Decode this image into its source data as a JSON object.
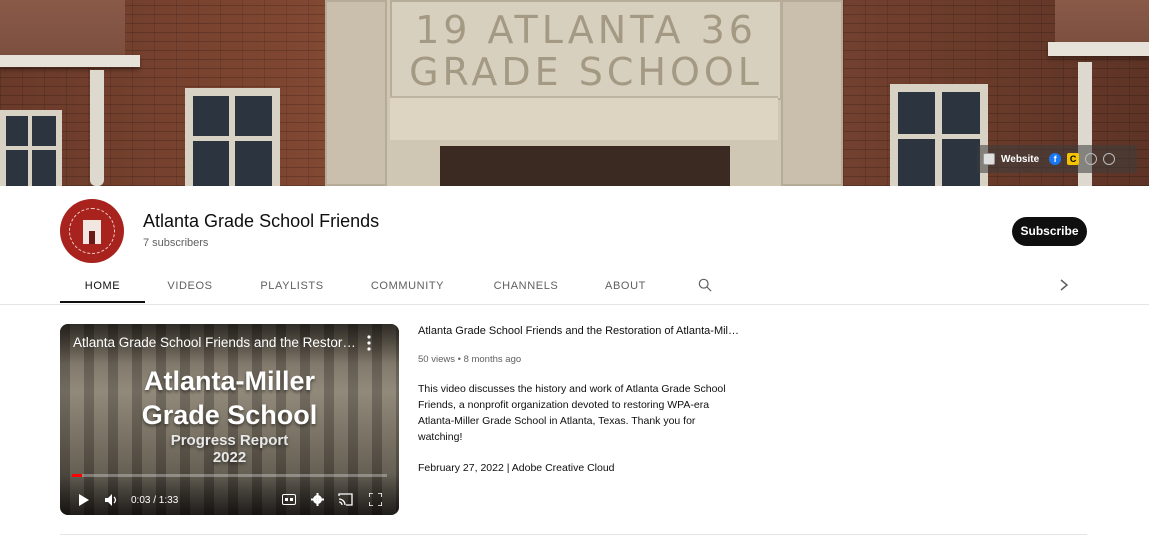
{
  "banner": {
    "plaque_line1": "19 ATLANTA 36",
    "plaque_line2": "GRADE SCHOOL",
    "links": {
      "website_label": "Website",
      "icons": [
        "website-icon",
        "facebook-icon",
        "c-icon",
        "globe-icon",
        "globe-icon"
      ]
    }
  },
  "channel": {
    "name": "Atlanta Grade School Friends",
    "subscribers": "7 subscribers",
    "subscribe_label": "Subscribe",
    "avatar_text": "ATLANTA GRADE SCHOOL FRIENDS"
  },
  "tabs": [
    {
      "label": "HOME",
      "active": true
    },
    {
      "label": "VIDEOS",
      "active": false
    },
    {
      "label": "PLAYLISTS",
      "active": false
    },
    {
      "label": "COMMUNITY",
      "active": false
    },
    {
      "label": "CHANNELS",
      "active": false
    },
    {
      "label": "ABOUT",
      "active": false
    }
  ],
  "player": {
    "overlay_title": "Atlanta Grade School Friends and the Restoration of Atlanta-Miller Grade School",
    "thumb_line1": "Atlanta-Miller",
    "thumb_line2": "Grade School",
    "thumb_line3": "Progress Report",
    "thumb_line4": "2022",
    "time": "0:03 / 1:33",
    "progress": 0.032
  },
  "video": {
    "title": "Atlanta Grade School Friends and the Restoration of Atlanta-Miller Grade School",
    "meta": "50 views • 8 months ago",
    "description": "This video discusses the history and work of Atlanta Grade School Friends, a nonprofit organization devoted to restoring WPA-era Atlanta-Miller Grade School in Atlanta, Texas. Thank you for watching!",
    "date_line": "February 27, 2022 | Adobe Creative Cloud"
  },
  "colors": {
    "subscribe_bg": "#0f0f0f",
    "progress": "#ff0000",
    "avatar": "#a8221e",
    "facebook": "#1877f2"
  }
}
